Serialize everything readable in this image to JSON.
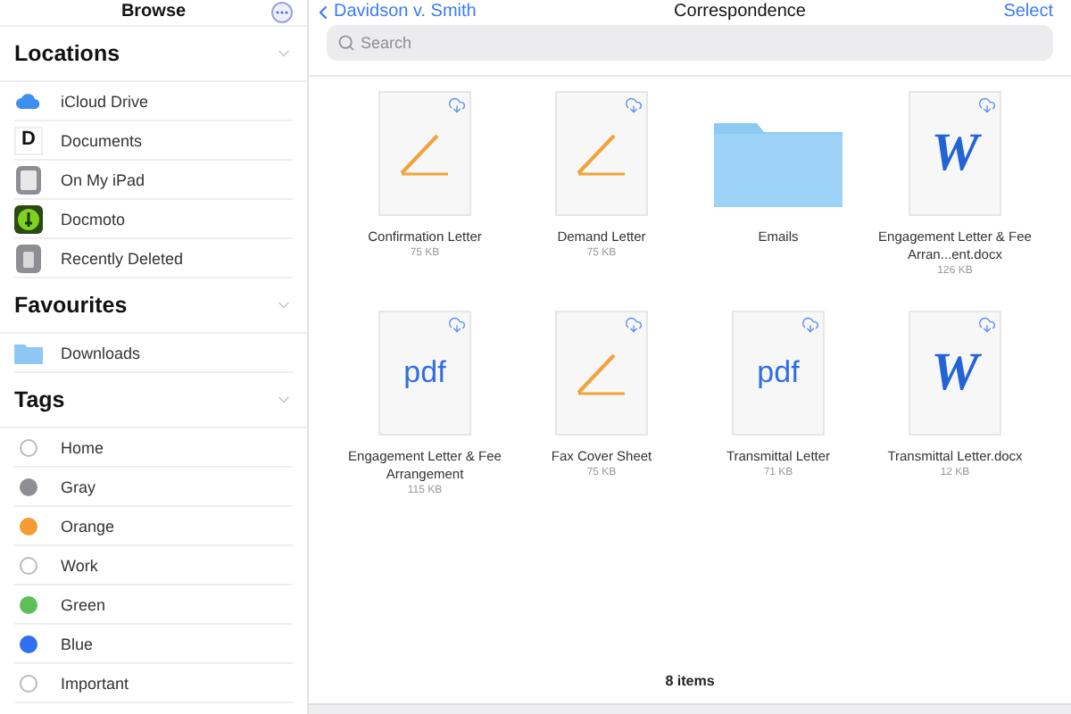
{
  "sidebar": {
    "title": "Browse",
    "sections": [
      {
        "heading": "Locations",
        "expanded": true,
        "items": [
          {
            "label": "iCloud Drive",
            "kind": "icloud"
          },
          {
            "label": "Documents",
            "kind": "letter",
            "icon_text": "D"
          },
          {
            "label": "On My iPad",
            "kind": "ipad"
          },
          {
            "label": "Docmoto",
            "kind": "docmoto"
          },
          {
            "label": "Recently Deleted",
            "kind": "trash"
          }
        ]
      },
      {
        "heading": "Favourites",
        "expanded": true,
        "items": [
          {
            "label": "Downloads",
            "kind": "folder"
          }
        ]
      },
      {
        "heading": "Tags",
        "expanded": true,
        "items": [
          {
            "label": "Home",
            "kind": "tag"
          },
          {
            "label": "Gray",
            "kind": "tag",
            "color": "#8e8e93"
          },
          {
            "label": "Orange",
            "kind": "tag",
            "color": "#f39c33"
          },
          {
            "label": "Work",
            "kind": "tag"
          },
          {
            "label": "Green",
            "kind": "tag",
            "color": "#5cbf5a"
          },
          {
            "label": "Blue",
            "kind": "tag",
            "color": "#2f6ff0"
          },
          {
            "label": "Important",
            "kind": "tag"
          }
        ]
      }
    ]
  },
  "nav": {
    "back": "Davidson v. Smith",
    "title": "Correspondence",
    "action": "Select"
  },
  "search": {
    "placeholder": "Search"
  },
  "files": [
    {
      "name": "Confirmation Letter",
      "size": "75 KB",
      "kind": "pages",
      "cloud": true
    },
    {
      "name": "Demand Letter",
      "size": "75 KB",
      "kind": "pages",
      "cloud": true
    },
    {
      "name": "Emails",
      "kind": "folder",
      "cloud": false
    },
    {
      "name": "Engagement Letter & Fee Arran...ent.docx",
      "size": "126 KB",
      "kind": "word",
      "icon_text": "W",
      "cloud": true
    },
    {
      "name": "Engagement Letter & Fee Arrangement",
      "size": "115 KB",
      "kind": "pdf",
      "icon_text": "pdf",
      "cloud": true
    },
    {
      "name": "Fax Cover Sheet",
      "size": "75 KB",
      "kind": "pages",
      "cloud": true
    },
    {
      "name": "Transmittal Letter",
      "size": "71 KB",
      "kind": "pdf",
      "icon_text": "pdf",
      "cloud": true
    },
    {
      "name": "Transmittal Letter.docx",
      "size": "12 KB",
      "kind": "word",
      "icon_text": "W",
      "cloud": true
    }
  ],
  "status": "8 items"
}
